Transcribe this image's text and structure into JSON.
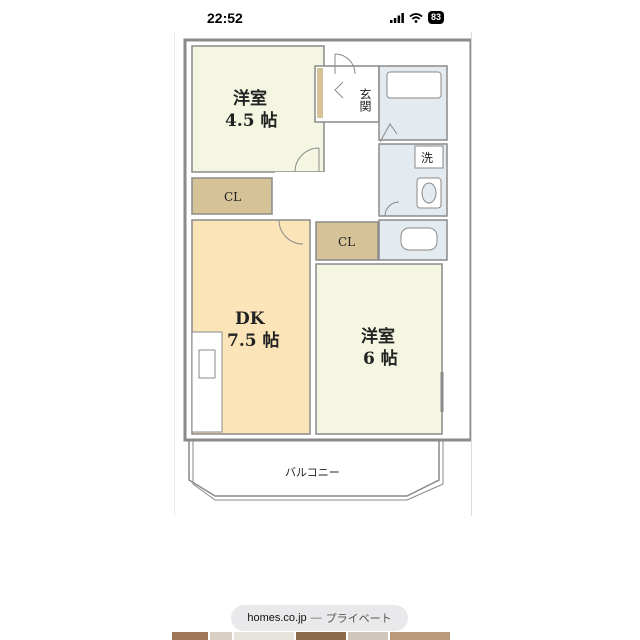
{
  "status_bar": {
    "time": "22:52",
    "battery": "83",
    "icons": [
      "signal-icon",
      "wifi-icon",
      "battery-icon"
    ]
  },
  "floor_plan": {
    "rooms": {
      "western_room_small": {
        "name": "洋室",
        "size": "4.5 帖"
      },
      "entrance": {
        "name": "玄関"
      },
      "washroom": {
        "name": "洗"
      },
      "closet_1": {
        "name": "CL"
      },
      "closet_2": {
        "name": "CL"
      },
      "dk": {
        "name": "DK",
        "size": "7.5 帖"
      },
      "western_room_large": {
        "name": "洋室",
        "size": "6 帖"
      },
      "balcony": {
        "name": "バルコニー"
      }
    },
    "colors": {
      "western_room": "#f5f6e2",
      "dk": "#fbe5b8",
      "closet": "#d5c397",
      "wet_area": "#e3ebf0",
      "wall": "#8a8a8a",
      "hall": "#ffffff"
    }
  },
  "url_pill": {
    "domain": "homes.co.jp",
    "separator": "—",
    "label": "プライベート"
  }
}
